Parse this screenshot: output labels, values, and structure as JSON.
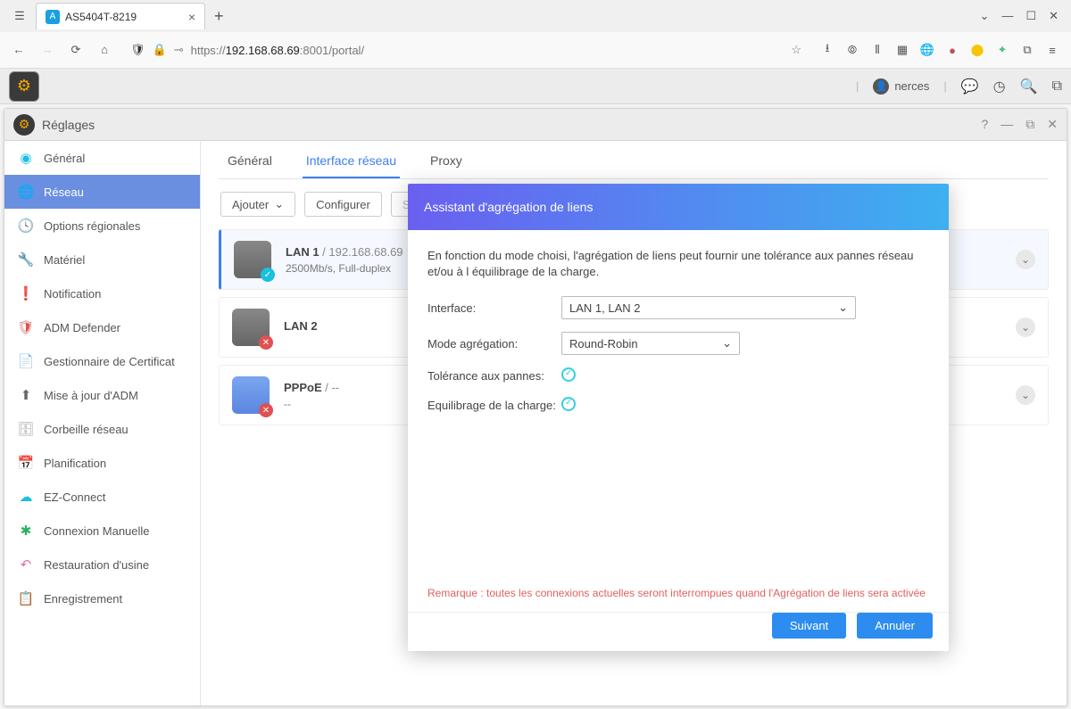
{
  "browser": {
    "tab_title": "AS5404T-8219",
    "url_prefix": "https://",
    "url_host": "192.168.68.69",
    "url_suffix": ":8001/portal/"
  },
  "adm": {
    "username": "nerces"
  },
  "window": {
    "title": "Réglages"
  },
  "sidebar": {
    "items": [
      {
        "label": "Général",
        "icon": "◉",
        "cls": "icon-color-1"
      },
      {
        "label": "Réseau",
        "icon": "🌐",
        "cls": "icon-color-2",
        "active": true
      },
      {
        "label": "Options régionales",
        "icon": "🕓",
        "cls": "icon-color-1"
      },
      {
        "label": "Matériel",
        "icon": "🔧",
        "cls": "icon-color-3"
      },
      {
        "label": "Notification",
        "icon": "❗",
        "cls": "icon-color-4"
      },
      {
        "label": "ADM Defender",
        "icon": "🛡",
        "cls": "icon-color-5"
      },
      {
        "label": "Gestionnaire de Certificat",
        "icon": "📄",
        "cls": "icon-color-5"
      },
      {
        "label": "Mise à jour d'ADM",
        "icon": "⬆",
        "cls": "icon-color-6"
      },
      {
        "label": "Corbeille réseau",
        "icon": "🗄",
        "cls": "icon-color-3"
      },
      {
        "label": "Planification",
        "icon": "📅",
        "cls": "icon-color-6"
      },
      {
        "label": "EZ-Connect",
        "icon": "☁",
        "cls": "icon-color-1"
      },
      {
        "label": "Connexion Manuelle",
        "icon": "✱",
        "cls": "icon-color-7"
      },
      {
        "label": "Restauration d'usine",
        "icon": "↶",
        "cls": "icon-color-8"
      },
      {
        "label": "Enregistrement",
        "icon": "📋",
        "cls": "icon-color-2"
      }
    ]
  },
  "tabs": {
    "items": [
      {
        "label": "Général"
      },
      {
        "label": "Interface réseau",
        "active": true
      },
      {
        "label": "Proxy"
      }
    ]
  },
  "toolbar": {
    "add": "Ajouter",
    "configure": "Configurer",
    "delete": "Suppri"
  },
  "interfaces": [
    {
      "name": "LAN 1",
      "ip": "192.168.68.69",
      "sub": "2500Mb/s, Full-duplex",
      "status": "ok",
      "selected": true
    },
    {
      "name": "LAN 2",
      "ip": "",
      "sub": "",
      "status": "err"
    },
    {
      "name": "PPPoE",
      "ip": "--",
      "sub": "--",
      "status": "err",
      "pppoe": true
    }
  ],
  "modal": {
    "title": "Assistant d'agrégation de liens",
    "intro": "En fonction du mode choisi, l'agrégation de liens peut fournir une tolérance aux pannes réseau et/ou à l équilibrage de la charge.",
    "labels": {
      "interface": "Interface:",
      "mode": "Mode agrégation:",
      "tolerance": "Tolérance aux pannes:",
      "balancing": "Equilibrage de la charge:"
    },
    "values": {
      "interface": "LAN 1, LAN 2",
      "mode": "Round-Robin"
    },
    "remark": "Remarque : toutes les connexions actuelles seront interrompues quand l'Agrégation de liens sera activée",
    "buttons": {
      "next": "Suivant",
      "cancel": "Annuler"
    }
  }
}
